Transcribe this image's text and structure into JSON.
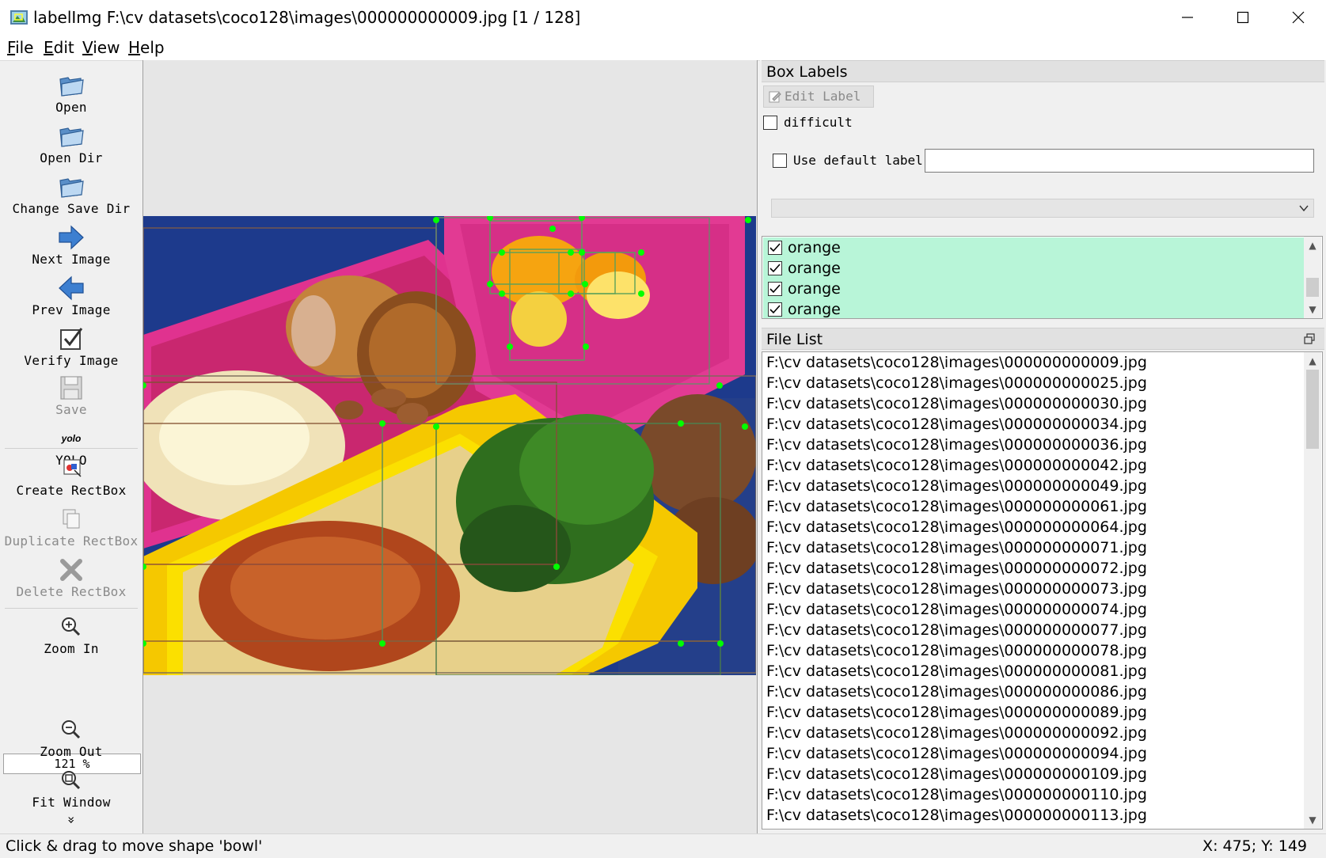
{
  "window": {
    "title": "labelImg F:\\cv datasets\\coco128\\images\\000000000009.jpg [1 / 128]"
  },
  "menu": [
    {
      "u": "F",
      "rest": "ile"
    },
    {
      "u": "E",
      "rest": "dit"
    },
    {
      "u": "V",
      "rest": "iew"
    },
    {
      "u": "H",
      "rest": "elp"
    }
  ],
  "toolbar": {
    "open": "Open",
    "open_dir": "Open Dir",
    "change_save_dir": "Change Save Dir",
    "next_image": "Next Image",
    "prev_image": "Prev Image",
    "verify_image": "Verify Image",
    "save": "Save",
    "format_icon_text": "yolo",
    "format": "YOLO",
    "create_rectbox": "Create RectBox",
    "duplicate_rectbox": "Duplicate RectBox",
    "delete_rectbox": "Delete RectBox",
    "zoom_in": "Zoom In",
    "zoom_value": "121 %",
    "zoom_out": "Zoom Out",
    "fit_window": "Fit Window",
    "more": "»"
  },
  "box_labels": {
    "title": "Box Labels",
    "edit_label": "Edit Label",
    "difficult": "difficult",
    "use_default_label": "Use default label",
    "default_label_value": "",
    "combo_value": "",
    "labels": [
      {
        "text": "orange",
        "checked": true
      },
      {
        "text": "orange",
        "checked": true
      },
      {
        "text": "orange",
        "checked": true
      },
      {
        "text": "orange",
        "checked": true
      }
    ]
  },
  "file_list": {
    "title": "File List",
    "files": [
      "F:\\cv datasets\\coco128\\images\\000000000009.jpg",
      "F:\\cv datasets\\coco128\\images\\000000000025.jpg",
      "F:\\cv datasets\\coco128\\images\\000000000030.jpg",
      "F:\\cv datasets\\coco128\\images\\000000000034.jpg",
      "F:\\cv datasets\\coco128\\images\\000000000036.jpg",
      "F:\\cv datasets\\coco128\\images\\000000000042.jpg",
      "F:\\cv datasets\\coco128\\images\\000000000049.jpg",
      "F:\\cv datasets\\coco128\\images\\000000000061.jpg",
      "F:\\cv datasets\\coco128\\images\\000000000064.jpg",
      "F:\\cv datasets\\coco128\\images\\000000000071.jpg",
      "F:\\cv datasets\\coco128\\images\\000000000072.jpg",
      "F:\\cv datasets\\coco128\\images\\000000000073.jpg",
      "F:\\cv datasets\\coco128\\images\\000000000074.jpg",
      "F:\\cv datasets\\coco128\\images\\000000000077.jpg",
      "F:\\cv datasets\\coco128\\images\\000000000078.jpg",
      "F:\\cv datasets\\coco128\\images\\000000000081.jpg",
      "F:\\cv datasets\\coco128\\images\\000000000086.jpg",
      "F:\\cv datasets\\coco128\\images\\000000000089.jpg",
      "F:\\cv datasets\\coco128\\images\\000000000092.jpg",
      "F:\\cv datasets\\coco128\\images\\000000000094.jpg",
      "F:\\cv datasets\\coco128\\images\\000000000109.jpg",
      "F:\\cv datasets\\coco128\\images\\000000000110.jpg",
      "F:\\cv datasets\\coco128\\images\\000000000113.jpg"
    ]
  },
  "status": {
    "message": "Click & drag to move shape 'bowl'",
    "coords": "X: 475; Y: 149"
  },
  "colors": {
    "label_row_bg": "#b8f5d8",
    "vertex_green": "#00ff00",
    "box_line": "#5a9a5a"
  }
}
